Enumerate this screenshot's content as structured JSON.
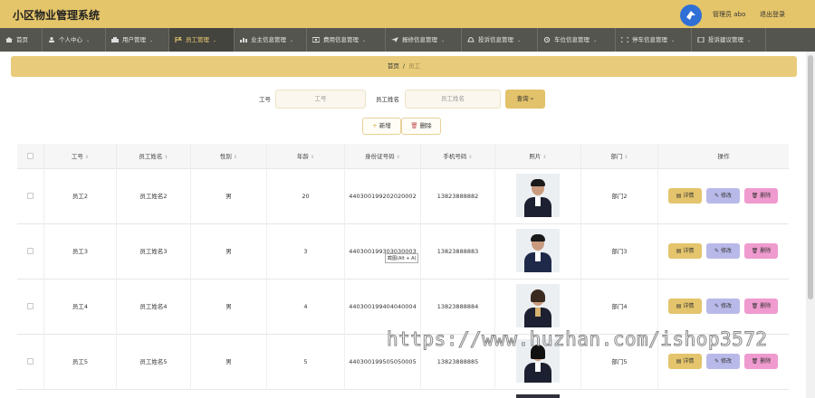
{
  "header": {
    "title": "小区物业管理系统",
    "admin": "管理员 abo",
    "logout": "退出登录"
  },
  "nav": [
    {
      "label": "首页",
      "icon": "home-icon",
      "dropdown": false
    },
    {
      "label": "个人中心",
      "icon": "user-icon",
      "dropdown": true
    },
    {
      "label": "用户管理",
      "icon": "users-icon",
      "dropdown": true
    },
    {
      "label": "员工管理",
      "icon": "flag-icon",
      "dropdown": true,
      "active": true
    },
    {
      "label": "业主信息管理",
      "icon": "chart-icon",
      "dropdown": true
    },
    {
      "label": "费用信息管理",
      "icon": "money-icon",
      "dropdown": true
    },
    {
      "label": "报修信息管理",
      "icon": "send-icon",
      "dropdown": true
    },
    {
      "label": "投诉信息管理",
      "icon": "bell-icon",
      "dropdown": true
    },
    {
      "label": "车位信息管理",
      "icon": "clock-icon",
      "dropdown": true
    },
    {
      "label": "停车信息管理",
      "icon": "expand-icon",
      "dropdown": true
    },
    {
      "label": "投诉建议管理",
      "icon": "note-icon",
      "dropdown": true
    }
  ],
  "breadcrumb": {
    "home": "首页",
    "separator": "/",
    "current": "员工"
  },
  "search": {
    "id_label": "工号",
    "id_placeholder": "工号",
    "name_label": "员工姓名",
    "name_placeholder": "员工姓名",
    "search_button": "查询"
  },
  "actions": {
    "add": "新增",
    "delete": "删除"
  },
  "table": {
    "headers": [
      "工号",
      "员工姓名",
      "性别",
      "年龄",
      "身份证号码",
      "手机号码",
      "照片",
      "部门",
      "操作"
    ],
    "rows": [
      {
        "id": "员工2",
        "name": "员工姓名2",
        "gender": "男",
        "age": "20",
        "idcard": "440300199202020002",
        "phone": "13823888882",
        "dept": "部门2"
      },
      {
        "id": "员工3",
        "name": "员工姓名3",
        "gender": "男",
        "age": "3",
        "idcard": "440300199303030003",
        "phone": "13823888883",
        "dept": "部门3"
      },
      {
        "id": "员工4",
        "name": "员工姓名4",
        "gender": "男",
        "age": "4",
        "idcard": "440300199404040004",
        "phone": "13823888884",
        "dept": "部门4"
      },
      {
        "id": "员工5",
        "name": "员工姓名5",
        "gender": "男",
        "age": "5",
        "idcard": "440300199505050005",
        "phone": "13823888885",
        "dept": "部门5"
      }
    ],
    "row_buttons": {
      "detail": "详情",
      "edit": "修改",
      "delete": "删除"
    }
  },
  "tooltip": "截图(Alt + A)",
  "watermark": "https://www.huzhan.com/ishop3572",
  "colors": {
    "accent": "#e5c56a",
    "nav_bg": "#55554f",
    "edit": "#b9b9e9",
    "delete": "#ef9bcf"
  }
}
